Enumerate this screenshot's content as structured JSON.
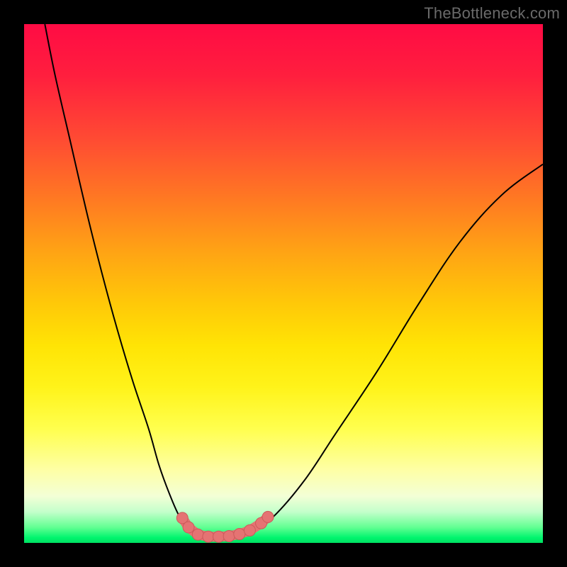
{
  "watermark": "TheBottleneck.com",
  "colors": {
    "frame": "#000000",
    "curve": "#000000",
    "markers_fill": "#e57373",
    "markers_stroke": "#cc5a5a",
    "gradient_top": "#ff0b44",
    "gradient_bottom": "#00e061"
  },
  "chart_data": {
    "type": "line",
    "title": "",
    "xlabel": "",
    "ylabel": "",
    "xlim": [
      0,
      100
    ],
    "ylim": [
      0,
      100
    ],
    "grid": false,
    "legend": false,
    "annotations": [
      "TheBottleneck.com"
    ],
    "series": [
      {
        "name": "left-branch",
        "x": [
          4,
          6,
          9,
          12,
          15,
          18,
          21,
          24,
          26,
          28,
          30,
          32
        ],
        "y": [
          100,
          90,
          77,
          64,
          52,
          41,
          31,
          22,
          15,
          9.5,
          5,
          2.5
        ]
      },
      {
        "name": "valley-floor",
        "x": [
          32,
          34,
          36,
          38,
          40,
          42,
          44
        ],
        "y": [
          2.5,
          1.5,
          1.2,
          1.2,
          1.3,
          1.6,
          2.3
        ]
      },
      {
        "name": "right-branch",
        "x": [
          44,
          48,
          54,
          60,
          68,
          76,
          84,
          92,
          100
        ],
        "y": [
          2.3,
          5,
          12,
          21,
          33,
          46,
          58,
          67,
          73
        ]
      }
    ],
    "markers": [
      {
        "x": 30.5,
        "y": 4.8
      },
      {
        "x": 31.7,
        "y": 3.0
      },
      {
        "x": 33.5,
        "y": 1.6
      },
      {
        "x": 35.5,
        "y": 1.2
      },
      {
        "x": 37.5,
        "y": 1.2
      },
      {
        "x": 39.5,
        "y": 1.3
      },
      {
        "x": 41.5,
        "y": 1.7
      },
      {
        "x": 43.5,
        "y": 2.4
      },
      {
        "x": 45.7,
        "y": 3.8
      },
      {
        "x": 47.0,
        "y": 5.0
      }
    ]
  }
}
